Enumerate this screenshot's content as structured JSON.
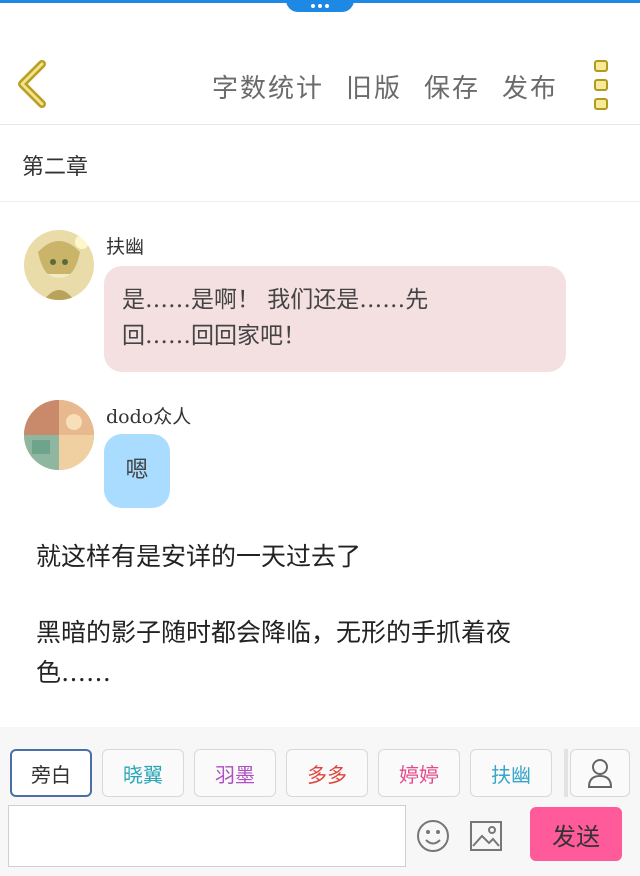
{
  "header": {
    "nav": [
      "字数统计",
      "旧版",
      "保存",
      "发布"
    ]
  },
  "chapter": {
    "title": "第二章"
  },
  "messages": [
    {
      "sender": "扶幽",
      "text_lines": [
        "是……是啊！ 我们还是……先",
        "回……回回家吧！"
      ],
      "bubble_color": "#f4dfe1"
    },
    {
      "sender": "dodo众人",
      "text_lines": [
        "嗯"
      ],
      "bubble_color": "#a9dcff"
    }
  ],
  "narration": [
    {
      "lines": [
        "就这样有是安详的一天过去了"
      ]
    },
    {
      "lines": [
        "黑暗的影子随时都会降临，无形的手抓着夜",
        "色……"
      ]
    }
  ],
  "roles": [
    {
      "label": "旁白",
      "color": "#333333",
      "active": true
    },
    {
      "label": "晓翼",
      "color": "#2aa6b8",
      "active": false
    },
    {
      "label": "羽墨",
      "color": "#b04fc4",
      "active": false
    },
    {
      "label": "多多",
      "color": "#e0433b",
      "active": false
    },
    {
      "label": "婷婷",
      "color": "#e64a8c",
      "active": false
    },
    {
      "label": "扶幽",
      "color": "#36a6c9",
      "active": false
    }
  ],
  "composer": {
    "input_value": "",
    "send_label": "发送"
  },
  "colors": {
    "accent": "#1e88e5",
    "send": "#ff5a9a",
    "menu": "#f4ea9a"
  }
}
